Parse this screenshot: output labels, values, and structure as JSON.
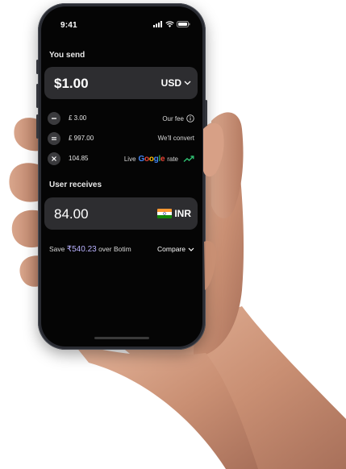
{
  "status_bar": {
    "time": "9:41",
    "icons": [
      "signal-icon",
      "wifi-icon",
      "battery-icon"
    ]
  },
  "send": {
    "label": "You send",
    "amount": "$1.00",
    "currency": "USD"
  },
  "fees": [
    {
      "operator": "minus",
      "value": "£ 3.00",
      "description": "Our fee",
      "info_icon": "info-icon"
    },
    {
      "operator": "equals",
      "value": "£ 997.00",
      "description": "We'll convert"
    },
    {
      "operator": "times",
      "value": "104.85",
      "description_prefix": "Live",
      "description_brand": "Google",
      "description_suffix": "rate",
      "trend_icon": "trending-up-icon"
    }
  ],
  "receive": {
    "label": "User receives",
    "amount": "84.00",
    "currency": "INR",
    "flag_icon": "india-flag-icon"
  },
  "savings": {
    "prefix": "Save",
    "amount": "₹540.23",
    "suffix": "over Botim",
    "compare_label": "Compare"
  },
  "colors": {
    "screen_bg": "#050505",
    "card_bg": "#2d2d30",
    "accent_purple": "#b9b2ff",
    "trend_green": "#2fbf71"
  }
}
